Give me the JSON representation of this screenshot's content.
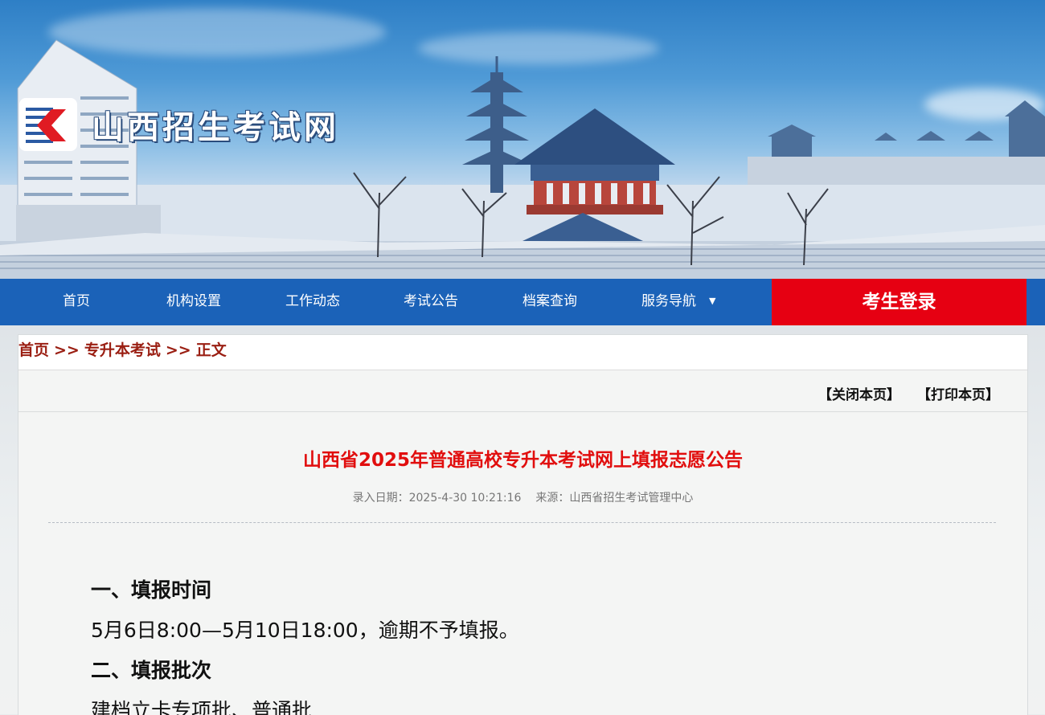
{
  "site": {
    "name": "山西招生考试网"
  },
  "nav": {
    "items": [
      {
        "label": "首页"
      },
      {
        "label": "机构设置"
      },
      {
        "label": "工作动态"
      },
      {
        "label": "考试公告"
      },
      {
        "label": "档案查询"
      },
      {
        "label": "服务导航",
        "has_dropdown": true
      }
    ],
    "login_label": "考生登录",
    "colors": {
      "bar": "#1b62b8",
      "login": "#e60012"
    }
  },
  "breadcrumb": {
    "items": [
      "首页",
      "专升本考试",
      "正文"
    ],
    "separator": ">>"
  },
  "tools": {
    "close_label": "【关闭本页】",
    "print_label": "【打印本页】"
  },
  "article": {
    "title": "山西省2025年普通高校专升本考试网上填报志愿公告",
    "date_label": "录入日期：",
    "date": "2025-4-30 10:21:16",
    "source_label": "来源：",
    "source": "山西省招生考试管理中心",
    "sections": [
      {
        "heading": "一、填报时间",
        "text": "5月6日8:00—5月10日18:00，逾期不予填报。"
      },
      {
        "heading": "二、填报批次",
        "text": "建档立卡专项批、普通批"
      }
    ]
  }
}
